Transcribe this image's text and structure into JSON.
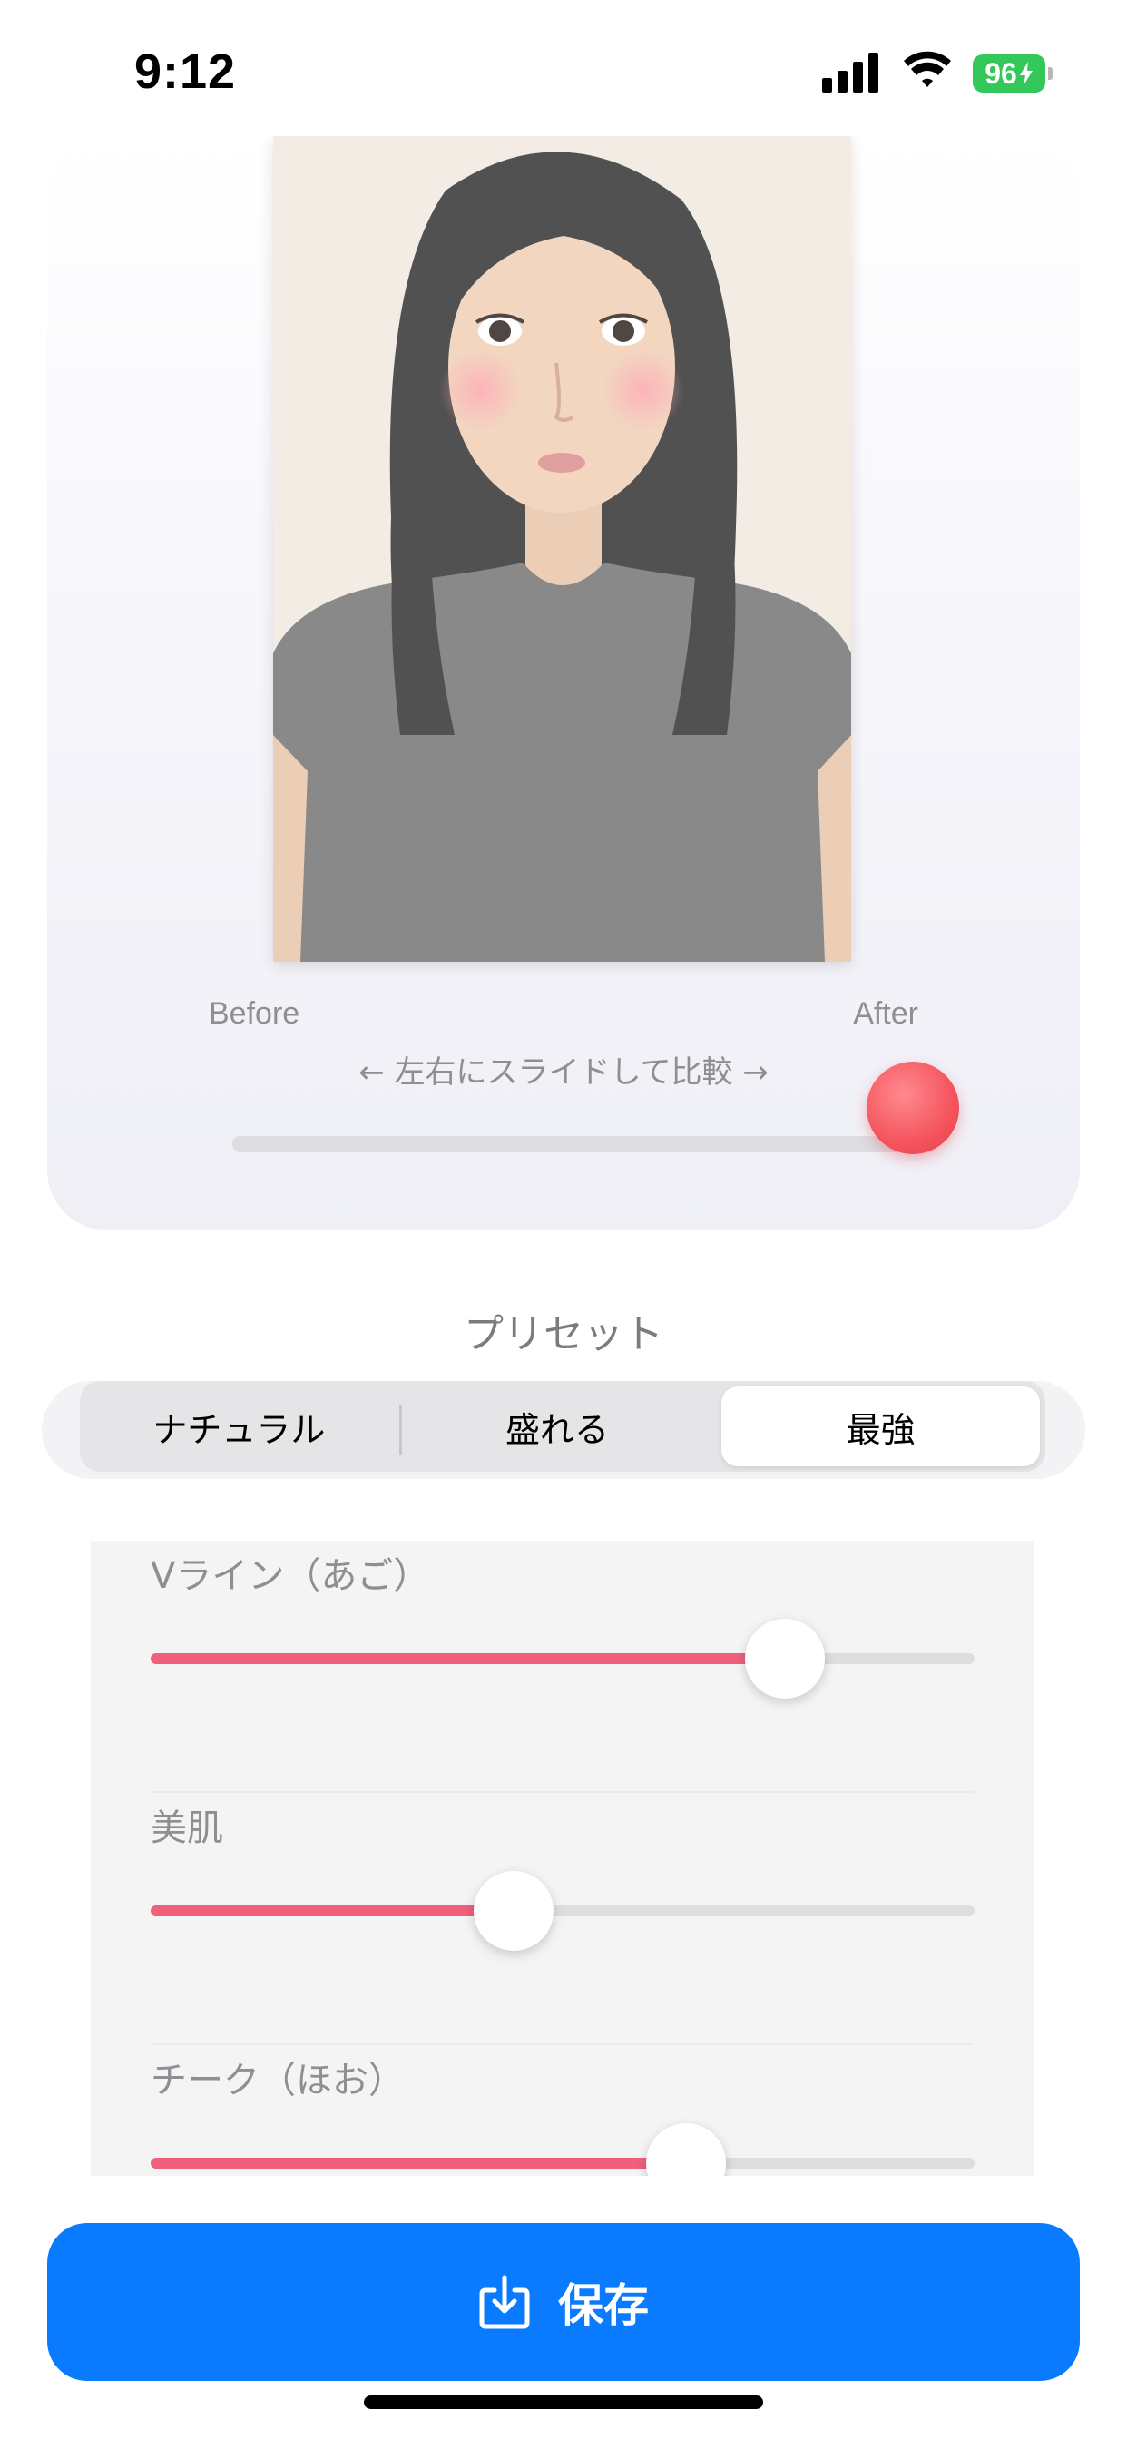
{
  "status_bar": {
    "time": "9:12",
    "battery_level": "96",
    "battery_color": "#34c759",
    "icons": [
      "cellular-signal-icon",
      "wifi-icon",
      "battery-charging-icon"
    ]
  },
  "preview": {
    "label_before": "Before",
    "label_after": "After",
    "compare_hint": "← 左右にスライドして比較 →",
    "compare_position": 1.0,
    "knob_color": "#f5545d"
  },
  "preset": {
    "title": "プリセット",
    "options": [
      "ナチュラル",
      "盛れる",
      "最強"
    ],
    "selected": "最強"
  },
  "sliders": [
    {
      "label": "Vライン（あご）",
      "value": 0.77
    },
    {
      "label": "美肌",
      "value": 0.44
    },
    {
      "label": "チーク（ほお）",
      "value": 0.65
    }
  ],
  "accent_color": "#f0607a",
  "save": {
    "label": "保存",
    "icon": "download-tray-icon",
    "color": "#0a7bff"
  }
}
